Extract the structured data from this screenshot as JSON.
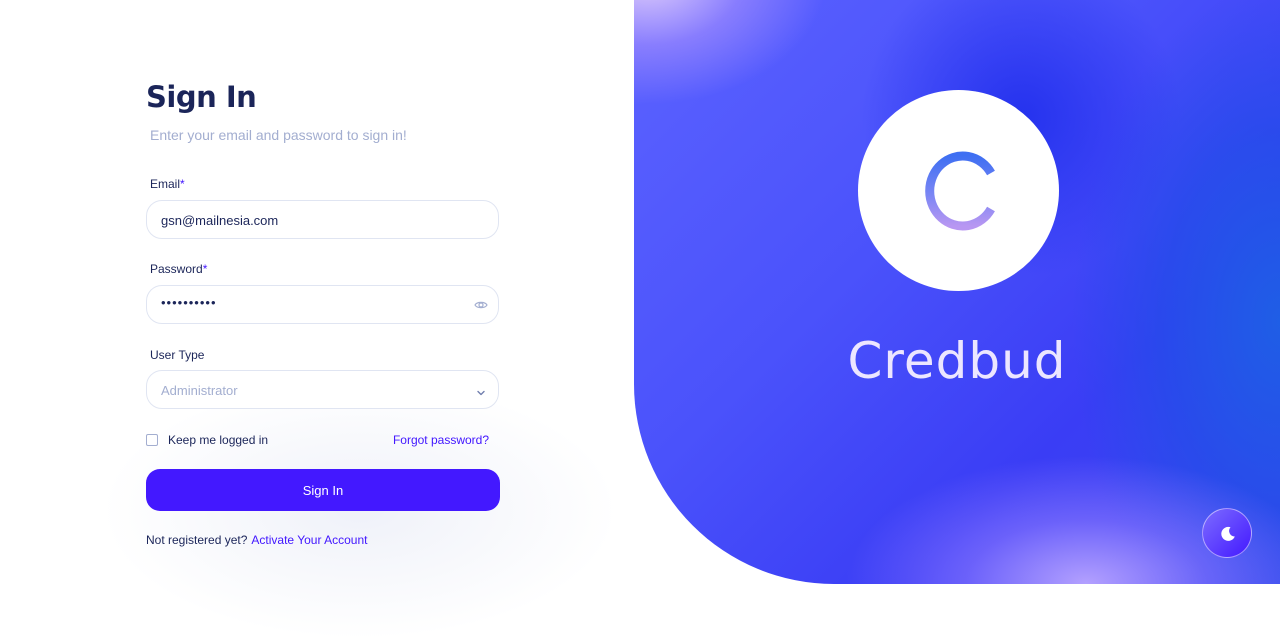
{
  "signin": {
    "title": "Sign In",
    "subtitle": "Enter your email and password to sign in!",
    "email_label": "Email",
    "email_value": "gsn@mailnesia.com",
    "password_label": "Password",
    "password_value": "••••••••••",
    "required_mark": "*",
    "user_type_label": "User Type",
    "user_type_value": "Administrator",
    "remember_label": "Keep me logged in",
    "forgot_label": "Forgot password?",
    "submit_label": "Sign In",
    "register_prompt": "Not registered yet?",
    "register_link": "Activate Your Account"
  },
  "brand": {
    "name": "Credbud",
    "logo_letter": "C"
  },
  "icons": {
    "password_toggle": "eye-icon",
    "select": "chevron-down-icon",
    "theme": "moon-icon"
  },
  "colors": {
    "accent": "#4318ff",
    "text_primary": "#1b2559",
    "text_muted": "#a3aed0",
    "border": "#e0e5f2"
  }
}
